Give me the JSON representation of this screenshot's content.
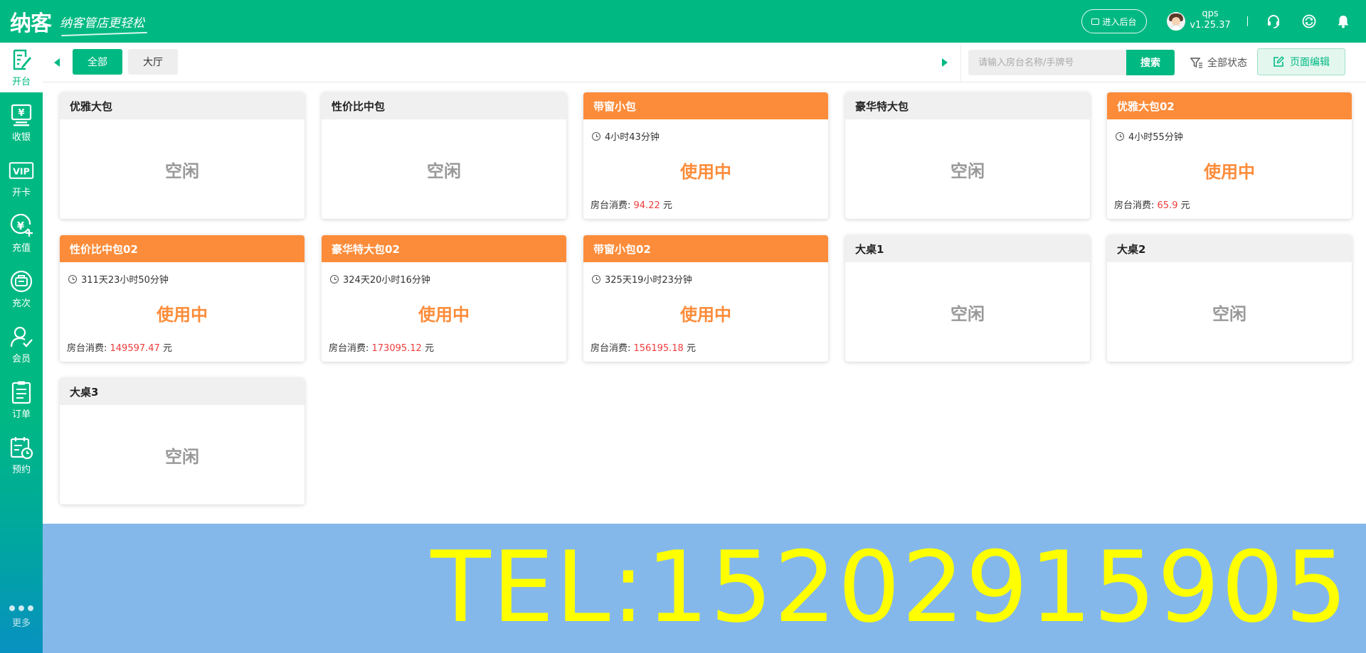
{
  "header": {
    "logo_text": "纳客",
    "slogan": "纳客管店更轻松",
    "backend_label": "进入后台",
    "username": "qps",
    "version": "v1.25.37",
    "icons": [
      "headset-icon",
      "refresh-icon",
      "bell-icon"
    ]
  },
  "sidebar": {
    "items": [
      {
        "label": "开台",
        "icon": "open-table-icon"
      },
      {
        "label": "收银",
        "icon": "cashier-icon"
      },
      {
        "label": "开卡",
        "icon": "vip-card-icon"
      },
      {
        "label": "充值",
        "icon": "recharge-icon"
      },
      {
        "label": "充次",
        "icon": "count-recharge-icon"
      },
      {
        "label": "会员",
        "icon": "member-icon"
      },
      {
        "label": "订单",
        "icon": "order-icon"
      },
      {
        "label": "预约",
        "icon": "booking-icon"
      }
    ],
    "active_index": 0,
    "more_label": "更多"
  },
  "toolbar": {
    "tabs": [
      {
        "label": "全部",
        "active": true
      },
      {
        "label": "大厅",
        "active": false
      }
    ],
    "search_placeholder": "请输入房台名称/手牌号",
    "search_value": "",
    "search_button": "搜索",
    "status_filter": "全部状态",
    "edit_button": "页面编辑"
  },
  "fee_label": "房台消费: ",
  "currency_unit": " 元",
  "rooms": [
    {
      "name": "优雅大包",
      "status": "空闲",
      "busy": false
    },
    {
      "name": "性价比中包",
      "status": "空闲",
      "busy": false
    },
    {
      "name": "带窗小包",
      "status": "使用中",
      "busy": true,
      "duration": "4小时43分钟",
      "fee": "94.22"
    },
    {
      "name": "豪华特大包",
      "status": "空闲",
      "busy": false
    },
    {
      "name": "优雅大包02",
      "status": "使用中",
      "busy": true,
      "duration": "4小时55分钟",
      "fee": "65.9"
    },
    {
      "name": "性价比中包02",
      "status": "使用中",
      "busy": true,
      "duration": "311天23小时50分钟",
      "fee": "149597.47"
    },
    {
      "name": "豪华特大包02",
      "status": "使用中",
      "busy": true,
      "duration": "324天20小时16分钟",
      "fee": "173095.12"
    },
    {
      "name": "带窗小包02",
      "status": "使用中",
      "busy": true,
      "duration": "325天19小时23分钟",
      "fee": "156195.18"
    },
    {
      "name": "大桌1",
      "status": "空闲",
      "busy": false
    },
    {
      "name": "大桌2",
      "status": "空闲",
      "busy": false
    },
    {
      "name": "大桌3",
      "status": "空闲",
      "busy": false
    }
  ],
  "colors": {
    "brand": "#00b982",
    "busy": "#fc8c3a",
    "fee": "#f03c3c",
    "banner_bg": "#85b8ea",
    "banner_text": "#ffff00"
  },
  "banner": {
    "text": "TEL:15202915905"
  }
}
